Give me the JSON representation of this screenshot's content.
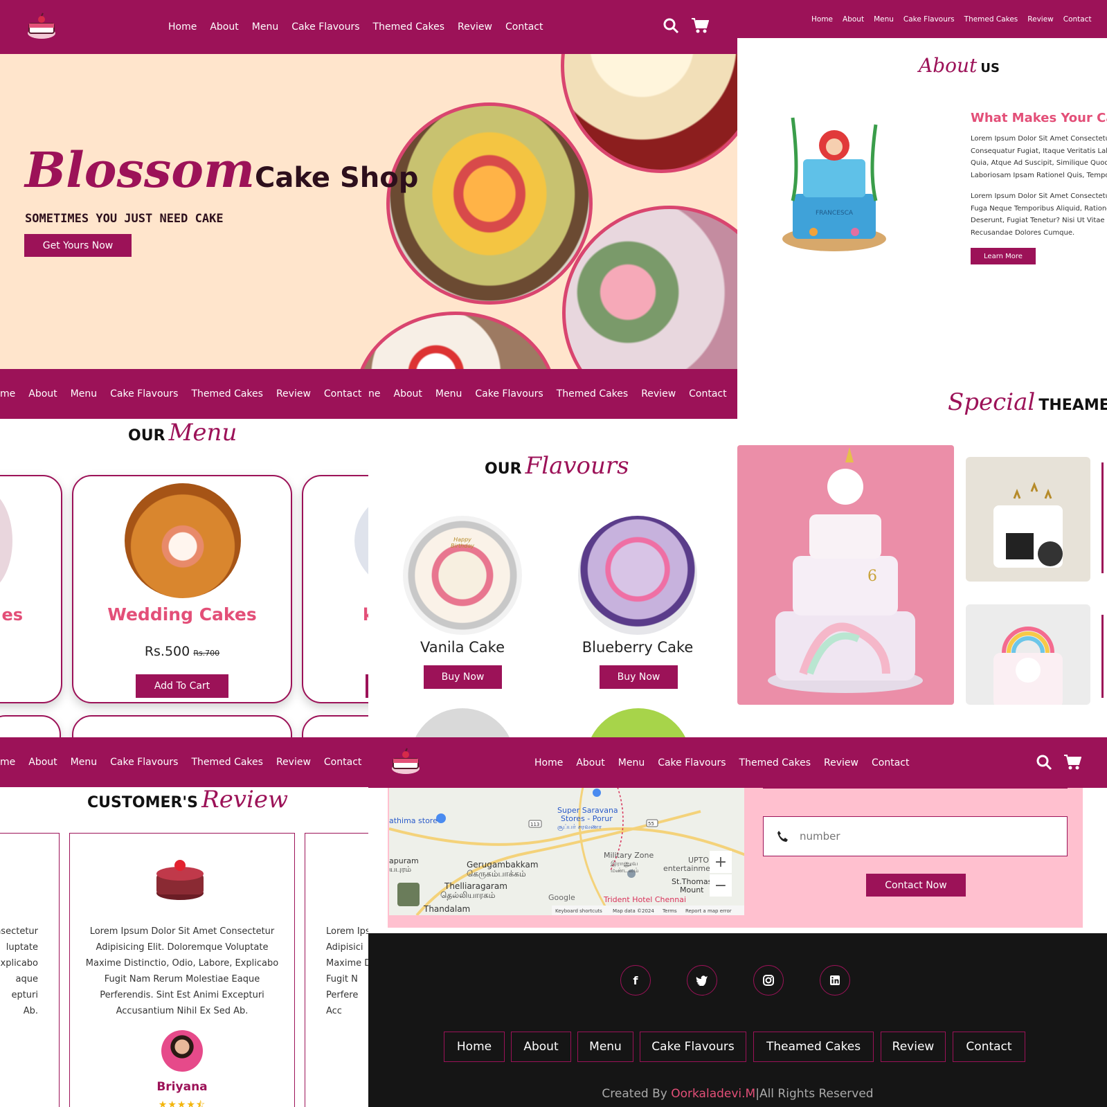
{
  "nav_links": [
    "Home",
    "About",
    "Menu",
    "Cake Flavours",
    "Themed Cakes",
    "Review",
    "Contact"
  ],
  "nav_links_partial": [
    "me",
    "About",
    "Menu",
    "Cake Flavours",
    "Themed Cakes",
    "Review",
    "Contact"
  ],
  "nav_links_partial_b": [
    "ne",
    "About",
    "Menu",
    "Cake Flavours",
    "Themed Cakes",
    "Review",
    "Contact"
  ],
  "hero": {
    "script_title": "Blossom",
    "title": "Cake Shop",
    "tagline": "SOMETIMES YOU JUST NEED CAKE",
    "cta": "Get Yours Now"
  },
  "about": {
    "script": "About",
    "word": "US",
    "heading": "What Makes Your Cal",
    "para1": [
      "Lorem Ipsum Dolor Sit Amet Consectetur",
      "Consequatur Fugiat, Itaque Veritatis Labo",
      "Quia, Atque Ad Suscipit, Similique Quod N",
      "Laboriosam Ipsam Rationel Quis, Tempo"
    ],
    "para2": [
      "Lorem Ipsum Dolor Sit Amet Consectetur",
      "Fuga Neque Temporibus Aliquid, Ratione",
      "Deserunt, Fugiat Tenetur? Nisi Ut Vitae No",
      "Recusandae Dolores Cumque."
    ],
    "cta": "Learn More",
    "cake_banner": "FRANCESCA"
  },
  "menu": {
    "word": "OUR",
    "script": "Menu",
    "card_title": "Wedding Cakes",
    "price": "Rs.500",
    "old_price": "Rs.700",
    "cta": "Add To Cart",
    "left_partial": "es",
    "right_partial": "k"
  },
  "flavours": {
    "word": "OUR",
    "script": "Flavours",
    "items": [
      {
        "name": "Vanila Cake",
        "cta": "Buy Now"
      },
      {
        "name": "Blueberry Cake",
        "cta": "Buy Now"
      }
    ],
    "topper": "Happy Birthday"
  },
  "themed": {
    "script": "Special",
    "word": "THEAMED",
    "cake_text": "6"
  },
  "review": {
    "word": "CUSTOMER'S",
    "script": "Review",
    "text": [
      "Lorem Ipsum Dolor Sit Amet Consectetur",
      "Adipisicing Elit. Doloremque Voluptate",
      "Maxime Distinctio, Odio, Labore, Explicabo",
      "Fugit Nam Rerum Molestiae Eaque",
      "Perferendis. Sint Est Animi Excepturi",
      "Accusantium Nihil Ex Sed Ab."
    ],
    "left_partial": [
      "nsectetur",
      "luptate",
      "Explicabo",
      "aque",
      "epturi",
      "Ab."
    ],
    "right_partial": [
      "Lorem Ips",
      "Adipisici",
      "Maxime D",
      "Fugit N",
      "Perfere",
      "Acc"
    ],
    "name": "Briyana",
    "stars": 4.5
  },
  "map": {
    "labels": [
      "Super Saravana",
      "Stores - Porur",
      "சூப்பர் சரவணா",
      "athima store",
      "apuram",
      "யபுரம்",
      "Gerugambakkam",
      "கெருகம்பாக்கம்",
      "Military Zone",
      "இராணுவ",
      "மண்டலம்",
      "UPTO",
      "entertainmen",
      "St.Thomas",
      "Mount",
      "Thelliaragaram",
      "தெல்லியாரகம்",
      "Thandalam",
      "Trident Hotel Chennai",
      "Google",
      "Keyboard shortcuts",
      "Map data ©2024",
      "Terms",
      "Report a map error",
      "113",
      "55"
    ]
  },
  "contact": {
    "placeholder": "number",
    "cta": "Contact Now"
  },
  "footer": {
    "social": [
      "f",
      "t",
      "ig",
      "in"
    ],
    "links": [
      "Home",
      "About",
      "Menu",
      "Cake Flavours",
      "Theamed Cakes",
      "Review",
      "Contact"
    ],
    "credit_prefix": "Created By ",
    "credit_name": "Oorkaladevi.M",
    "credit_suffix": "|All Rights Reserved"
  },
  "colors": {
    "brand": "#9c1258",
    "peach": "#ffe5cc",
    "pink": "#f0a0bf",
    "light_pink": "#ffc0cf",
    "footer": "#151515"
  }
}
